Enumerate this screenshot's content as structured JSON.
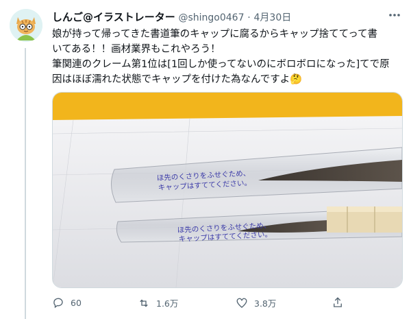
{
  "tweet": {
    "display_name": "しんご@イラストレーター",
    "handle": "@shingo0467",
    "separator": "·",
    "date": "4月30日",
    "more_icon": "more-icon",
    "text_lines": [
      "娘が持って帰ってきた書道筆のキャップに腐るからキャップ捨ててって書",
      "いてある！！画材業界もこれやろう！",
      "筆関連のクレーム第1位は[1回しか使ってないのにボロボロになった]てで原",
      "因はほぼ濡れた状態でキャップを付けた為なんですよ🤔"
    ]
  },
  "media": {
    "cap_text_1_line1": "ほ先のくさりをふせぐため、",
    "cap_text_1_line2": "キャップはすててください。",
    "cap_text_2_line1": "ほ先のくさりをふせぐため、",
    "cap_text_2_line2": "キャップはすててください。"
  },
  "actions": {
    "reply_count": "60",
    "retweet_count": "1.6万",
    "like_count": "3.8万"
  },
  "colors": {
    "secondary_text": "#536471",
    "thread_line": "#cfd9de",
    "background_yellow": "#f2b51c"
  }
}
